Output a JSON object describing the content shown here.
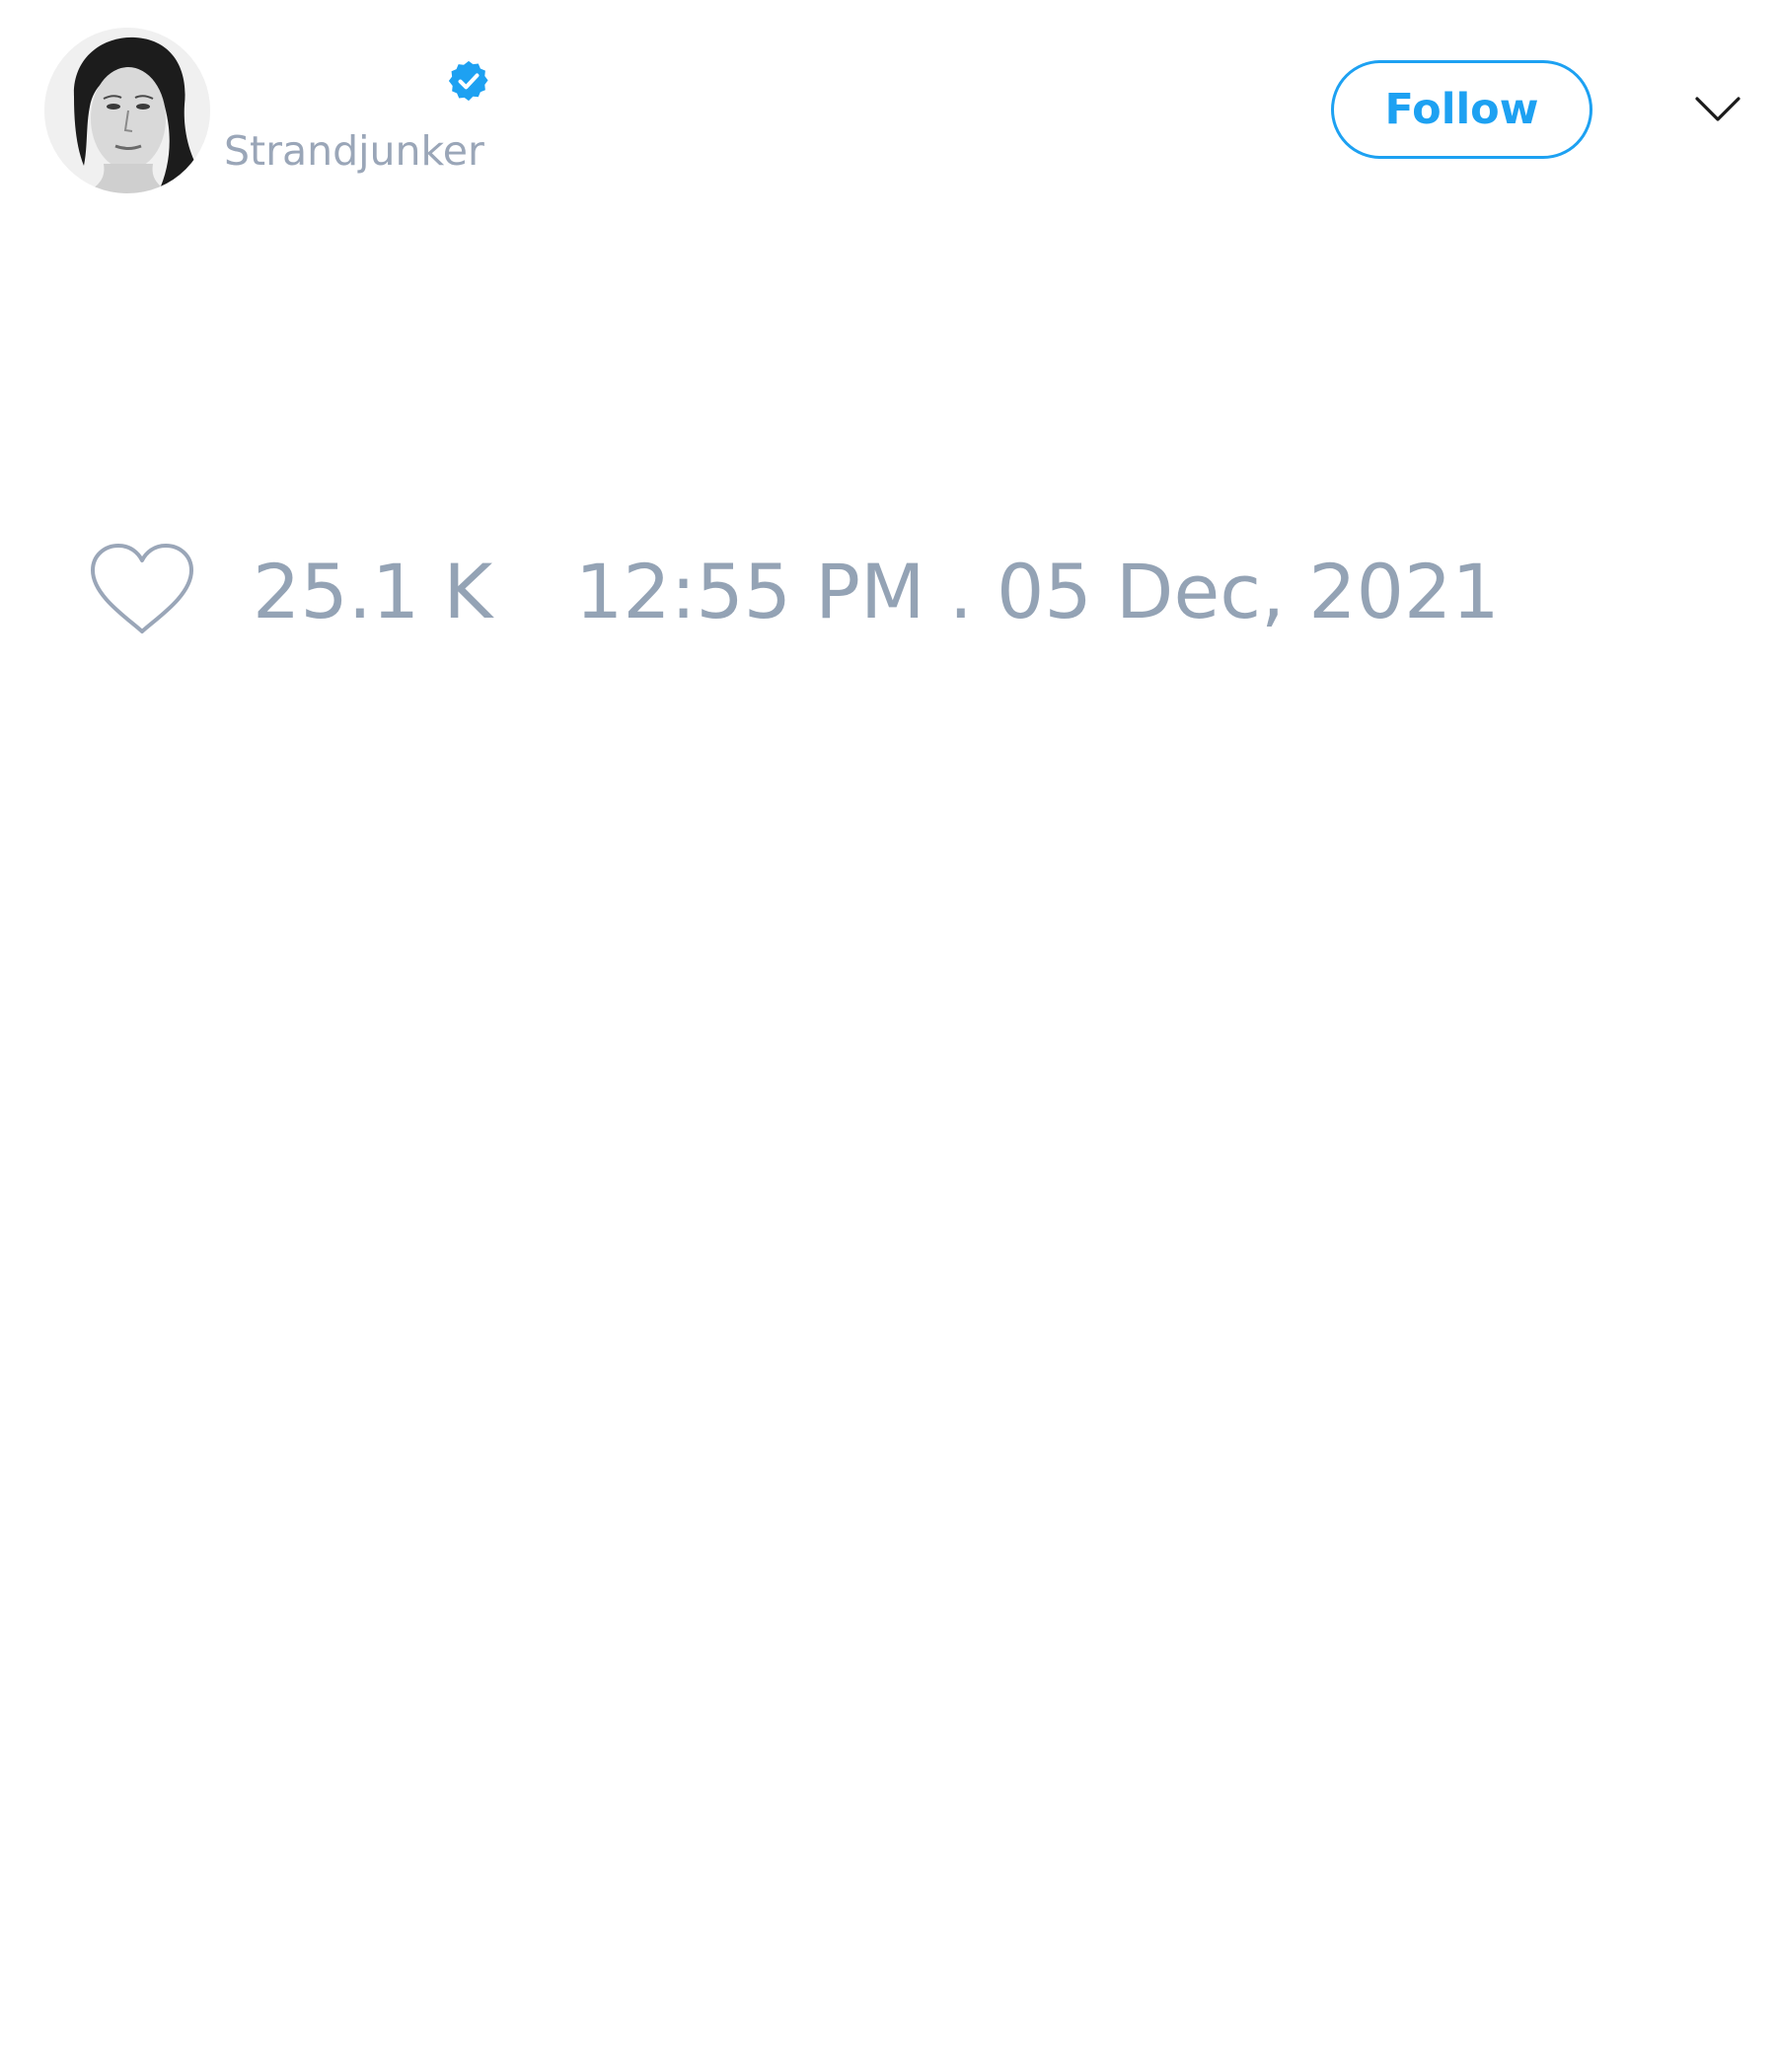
{
  "tweet": {
    "author": {
      "handle": "Strandjunker",
      "verified": true,
      "avatar_icon": "profile-photo"
    },
    "follow_label": "Follow",
    "menu_icon": "chevron-down-icon",
    "likes": {
      "icon": "heart-icon",
      "count": "25.1 K"
    },
    "timestamp": "12:55 PM . 05 Dec, 2021"
  },
  "colors": {
    "accent": "#1da1f2",
    "muted_text": "#94a3b5",
    "background": "#ffffff"
  }
}
